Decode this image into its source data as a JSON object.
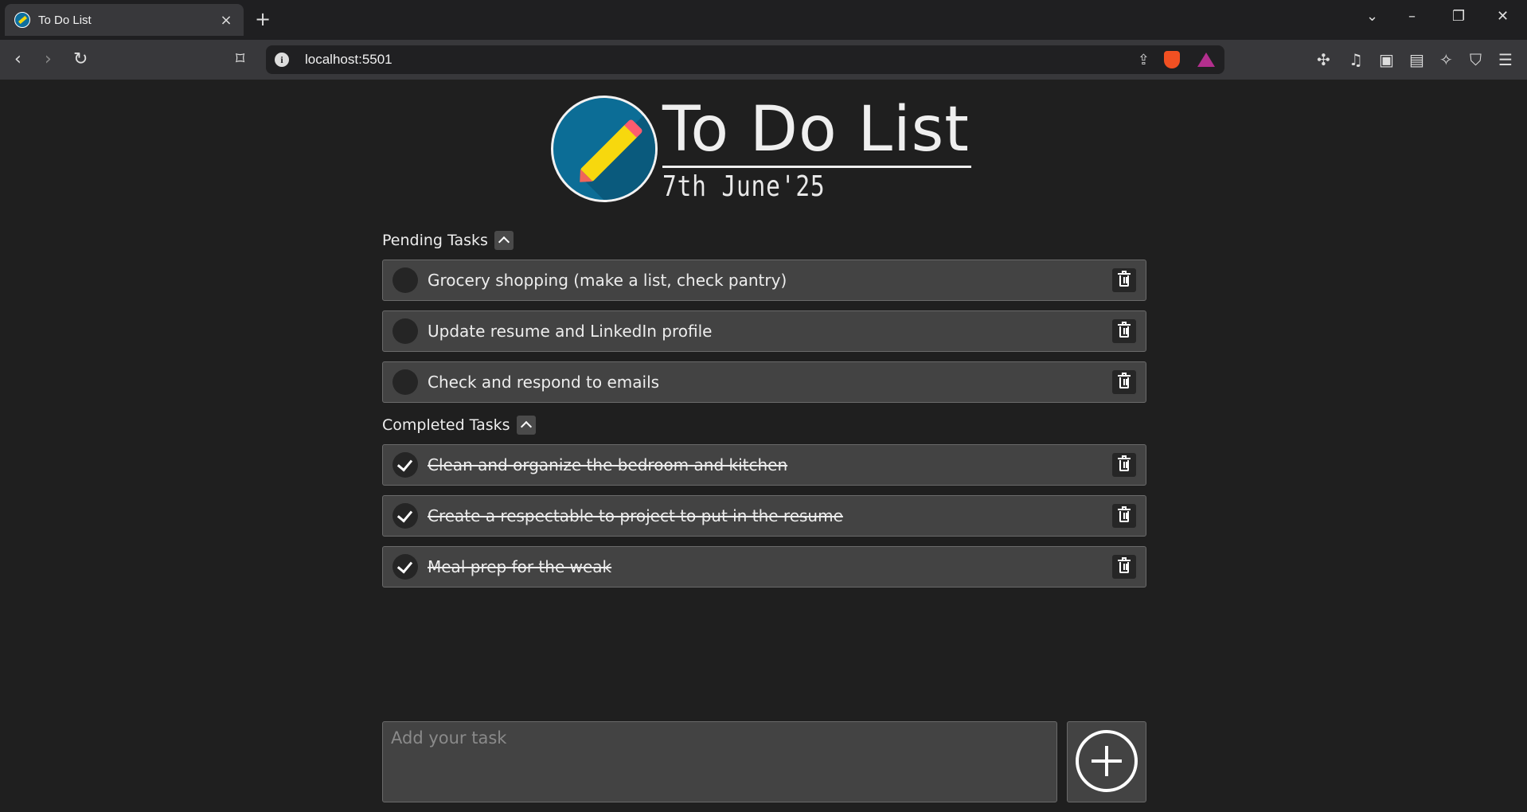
{
  "browser": {
    "tab_title": "To Do List",
    "tab_close": "×",
    "new_tab": "+",
    "url": "localhost:5501",
    "info": "i"
  },
  "app": {
    "title": "To Do List",
    "date": "7th June'25"
  },
  "pending": {
    "heading": "Pending Tasks",
    "tasks": [
      "Grocery shopping (make a list, check pantry)",
      "Update resume and LinkedIn profile",
      "Check and respond to emails"
    ]
  },
  "completed": {
    "heading": "Completed Tasks",
    "tasks": [
      "Clean and organize the bedroom and kitchen",
      "Create a respectable to project to put in the resume",
      "Meal prep for the weak"
    ]
  },
  "composer": {
    "placeholder": "Add your task"
  }
}
